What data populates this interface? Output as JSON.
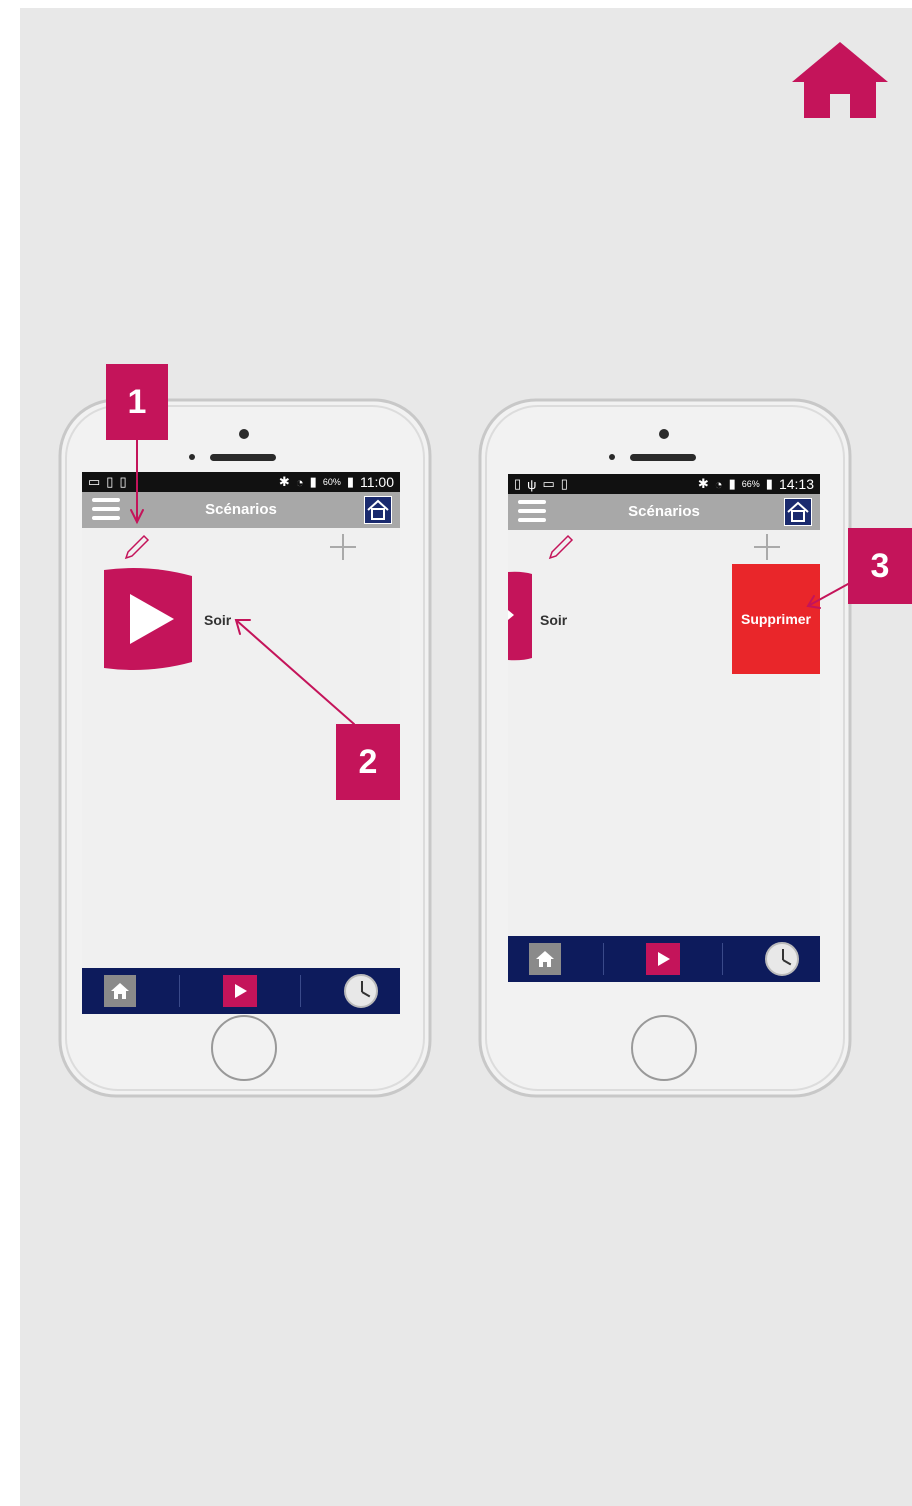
{
  "brand_color": "#c4145a",
  "delete_color": "#e9262a",
  "nav_color": "#0d1b5c",
  "corner_icon": "home-icon",
  "steps": [
    "1",
    "2",
    "3"
  ],
  "phone_left": {
    "status": {
      "percent": "60%",
      "time": "11:00"
    },
    "header_title": "Scénarios",
    "scenario_label": "Soir"
  },
  "phone_right": {
    "status": {
      "percent": "66%",
      "time": "14:13"
    },
    "header_title": "Scénarios",
    "scenario_label": "Soir",
    "delete_label": "Supprimer"
  }
}
